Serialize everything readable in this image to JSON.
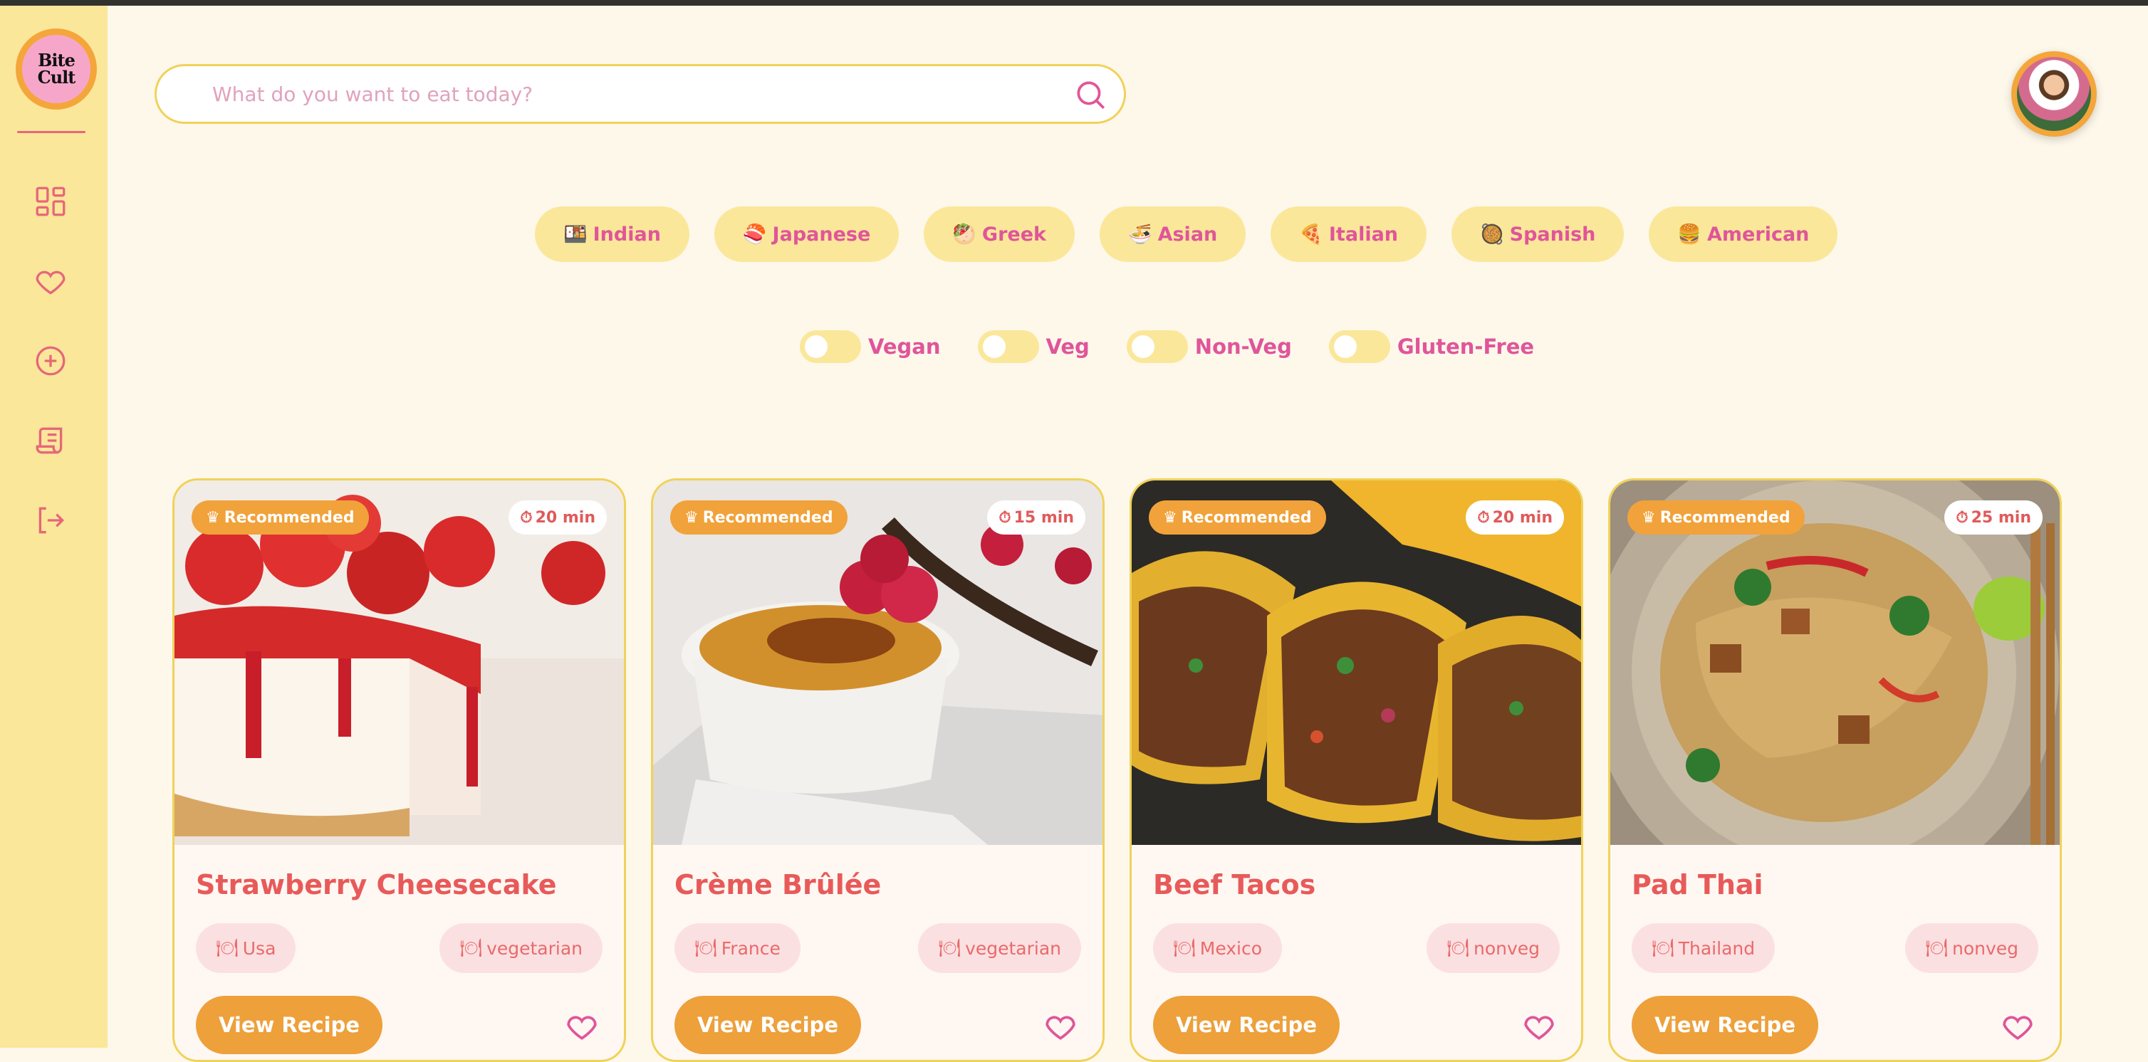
{
  "brand": {
    "logo_text": "Bite Cult"
  },
  "sidebar": {
    "items": [
      {
        "icon": "dashboard-icon"
      },
      {
        "icon": "heart-icon"
      },
      {
        "icon": "add-circle-icon"
      },
      {
        "icon": "scroll-icon"
      },
      {
        "icon": "logout-icon"
      }
    ]
  },
  "search": {
    "placeholder": "What do you want to eat today?",
    "value": ""
  },
  "cuisines": [
    {
      "emoji": "🍱",
      "label": "Indian"
    },
    {
      "emoji": "🍣",
      "label": "Japanese"
    },
    {
      "emoji": "🥙",
      "label": "Greek"
    },
    {
      "emoji": "🍜",
      "label": "Asian"
    },
    {
      "emoji": "🍕",
      "label": "Italian"
    },
    {
      "emoji": "🥘",
      "label": "Spanish"
    },
    {
      "emoji": "🍔",
      "label": "American"
    }
  ],
  "filters": [
    {
      "label": "Vegan",
      "on": false
    },
    {
      "label": "Veg",
      "on": false
    },
    {
      "label": "Non-Veg",
      "on": false
    },
    {
      "label": "Gluten-Free",
      "on": false
    }
  ],
  "cards": [
    {
      "badge": "Recommended",
      "time": "20 min",
      "title": "Strawberry Cheesecake",
      "origin": "Usa",
      "diet": "vegetarian",
      "button": "View Recipe"
    },
    {
      "badge": "Recommended",
      "time": "15 min",
      "title": "Crème Brûlée",
      "origin": "France",
      "diet": "vegetarian",
      "button": "View Recipe"
    },
    {
      "badge": "Recommended",
      "time": "20 min",
      "title": "Beef Tacos",
      "origin": "Mexico",
      "diet": "nonveg",
      "button": "View Recipe"
    },
    {
      "badge": "Recommended",
      "time": "25 min",
      "title": "Pad Thai",
      "origin": "Thailand",
      "diet": "nonveg",
      "button": "View Recipe"
    }
  ],
  "colors": {
    "accent": "#e0559a",
    "sidebar": "#fbe79a",
    "button": "#eea03b",
    "title": "#e85a5a"
  }
}
